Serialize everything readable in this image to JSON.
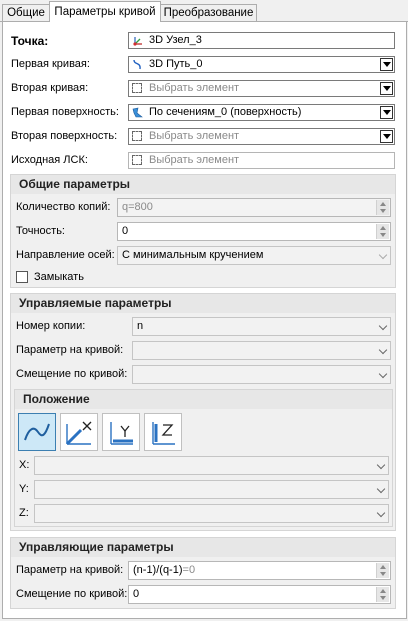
{
  "tabs": [
    "Общие",
    "Параметры кривой",
    "Преобразование"
  ],
  "top_fields": [
    {
      "label": "Точка:",
      "value": "3D Узел_3",
      "placeholder": false,
      "icon": "node-3d-icon"
    },
    {
      "label": "Первая кривая:",
      "value": "3D Путь_0",
      "placeholder": false,
      "icon": "path-3d-icon"
    },
    {
      "label": "Вторая кривая:",
      "value": "Выбрать элемент",
      "placeholder": true,
      "icon": "select-element-icon"
    },
    {
      "label": "Первая поверхность:",
      "value": "По сечениям_0 (поверхность)",
      "placeholder": false,
      "icon": "loft-surface-icon"
    },
    {
      "label": "Вторая поверхность:",
      "value": "Выбрать элемент",
      "placeholder": true,
      "icon": "select-element-icon"
    },
    {
      "label": "Исходная ЛСК:",
      "value": "Выбрать элемент",
      "placeholder": true,
      "icon": "select-element-icon"
    }
  ],
  "general": {
    "title": "Общие параметры",
    "copies_label": "Количество копий:",
    "copies_value": "q=800",
    "precision_label": "Точность:",
    "precision_value": "0",
    "axis_label": "Направление осей:",
    "axis_value": "С минимальным кручением",
    "close_label": "Замыкать",
    "close_checked": false
  },
  "managed": {
    "title": "Управляемые параметры",
    "copy_number_label": "Номер копии:",
    "copy_number_value": "n",
    "param_label": "Параметр на кривой:",
    "param_value": "",
    "offset_label": "Смещение по кривой:",
    "offset_value": ""
  },
  "position": {
    "title": "Положение",
    "buttons": [
      "curve-mode-icon",
      "axis-x-icon",
      "axis-y-icon",
      "axis-z-icon"
    ],
    "x_label": "X:",
    "y_label": "Y:",
    "z_label": "Z:"
  },
  "control": {
    "title": "Управляющие параметры",
    "param_label": "Параметр на кривой:",
    "param_expr": "(n-1)/(q-1)",
    "param_result": "=0",
    "offset_label": "Смещение по кривой:",
    "offset_value": "0"
  }
}
